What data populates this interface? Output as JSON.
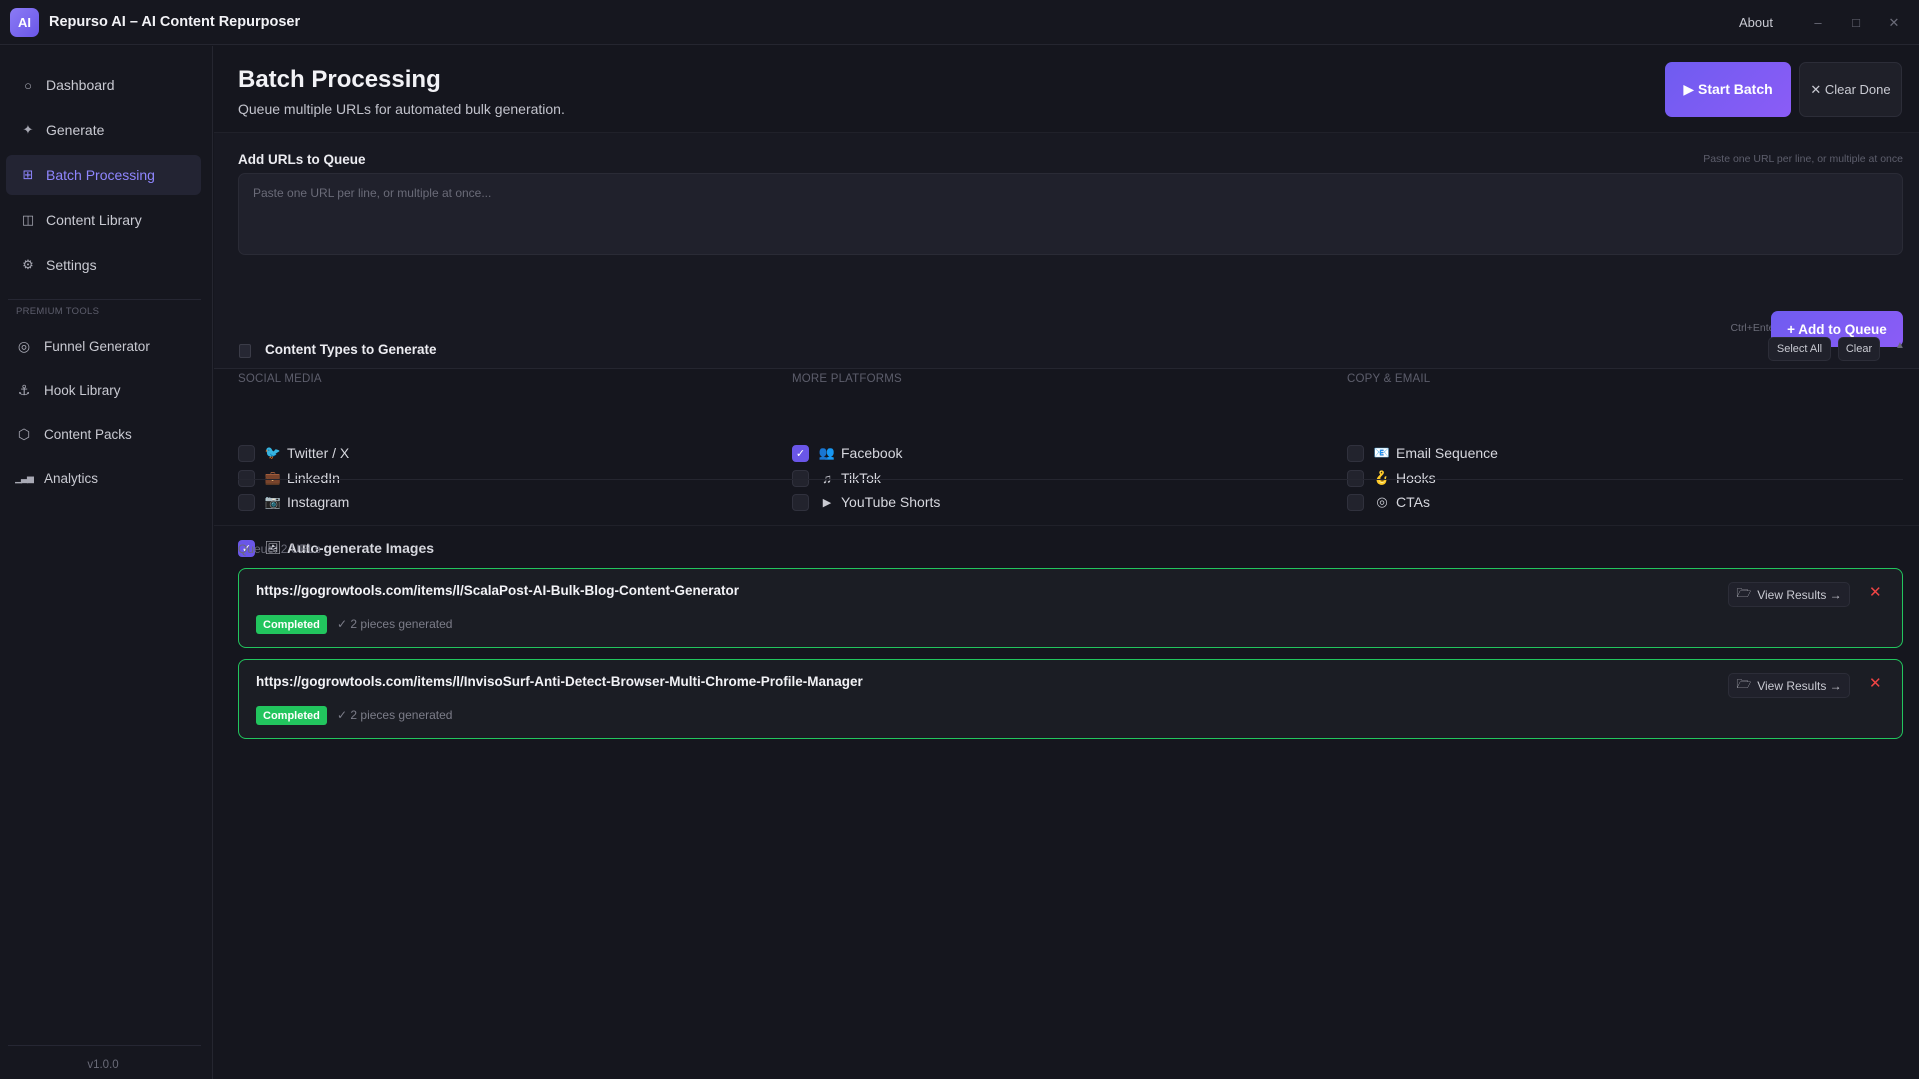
{
  "titlebar": {
    "logo_text": "AI",
    "title": "Repurso AI – AI Content Repurposer",
    "about": "About",
    "minimize": "–",
    "maximize": "□",
    "close": "✕"
  },
  "sidebar": {
    "items": [
      {
        "label": "Dashboard",
        "icon": "circle-icon",
        "glyph": "○"
      },
      {
        "label": "Generate",
        "icon": "sparkle-icon",
        "glyph": "✦"
      },
      {
        "label": "Batch Processing",
        "icon": "grid-icon",
        "glyph": "⊞"
      },
      {
        "label": "Content Library",
        "icon": "book-icon",
        "glyph": "◫"
      },
      {
        "label": "Settings",
        "icon": "gear-icon",
        "glyph": "⚙"
      }
    ],
    "active_item": "Batch Processing",
    "premium_label": "PREMIUM TOOLS",
    "premium_items": [
      {
        "label": "Funnel Generator",
        "icon": "target-icon",
        "glyph": "◎"
      },
      {
        "label": "Hook Library",
        "icon": "anchor-icon",
        "glyph": "⚓"
      },
      {
        "label": "Content Packs",
        "icon": "package-icon",
        "glyph": "⬡"
      },
      {
        "label": "Analytics",
        "icon": "bar-chart-icon",
        "glyph": "▁▃▅"
      }
    ],
    "version": "v1.0.0"
  },
  "header": {
    "title": "Batch Processing",
    "subtitle": "Queue multiple URLs for automated bulk generation.",
    "start_label": "▶ Start Batch",
    "clear_done_label": "✕ Clear Done"
  },
  "add_urls": {
    "label": "Add URLs to Queue",
    "hint": "Paste one URL per line, or multiple at once",
    "value": "",
    "placeholder": "Paste one URL per line, or multiple at once...",
    "shortcut": "Ctrl+Enter",
    "add_button": "+ Add to Queue"
  },
  "content_types": {
    "title": "Content Types to Generate",
    "select_all": "Select All",
    "clear": "Clear",
    "columns": [
      {
        "label": "SOCIAL MEDIA",
        "items": [
          {
            "label": "Twitter / X",
            "glyph": "🐦",
            "icon": "bird-icon",
            "checked": false
          },
          {
            "label": "LinkedIn",
            "glyph": "💼",
            "icon": "briefcase-icon",
            "checked": false
          },
          {
            "label": "Instagram",
            "glyph": "📷",
            "icon": "camera-icon",
            "checked": false
          }
        ]
      },
      {
        "label": "MORE PLATFORMS",
        "items": [
          {
            "label": "Facebook",
            "glyph": "👥",
            "icon": "people-icon",
            "checked": true
          },
          {
            "label": "TikTok",
            "glyph": "♫",
            "icon": "music-icon",
            "checked": false
          },
          {
            "label": "YouTube Shorts",
            "glyph": "▶",
            "icon": "play-icon",
            "checked": false
          }
        ]
      },
      {
        "label": "COPY & EMAIL",
        "items": [
          {
            "label": "Email Sequence",
            "glyph": "📧",
            "icon": "email-icon",
            "checked": false
          },
          {
            "label": "Hooks",
            "glyph": "🪝",
            "icon": "hook-icon",
            "checked": false
          },
          {
            "label": "CTAs",
            "glyph": "◎",
            "icon": "target-icon",
            "checked": false
          }
        ]
      }
    ],
    "auto_images": {
      "label": "Auto-generate Images",
      "glyph": "🖼",
      "checked": true
    }
  },
  "queue": {
    "label": "Queue: 2 URLs",
    "items": [
      {
        "url": "https://gogrowtools.com/items/l/ScalaPost-AI-Bulk-Blog-Content-Generator",
        "status": "Completed",
        "pieces": "✓ 2 pieces generated",
        "view_label": "View Results →"
      },
      {
        "url": "https://gogrowtools.com/items/l/InvisoSurf-Anti-Detect-Browser-Multi-Chrome-Profile-Manager",
        "status": "Completed",
        "pieces": "✓ 2 pieces generated",
        "view_label": "View Results →"
      }
    ]
  },
  "colors": {
    "accent": "#6a56e8",
    "active_nav_text": "#8f86ff",
    "success": "#22c55e",
    "danger": "#ef4444",
    "background": "#15161e"
  }
}
